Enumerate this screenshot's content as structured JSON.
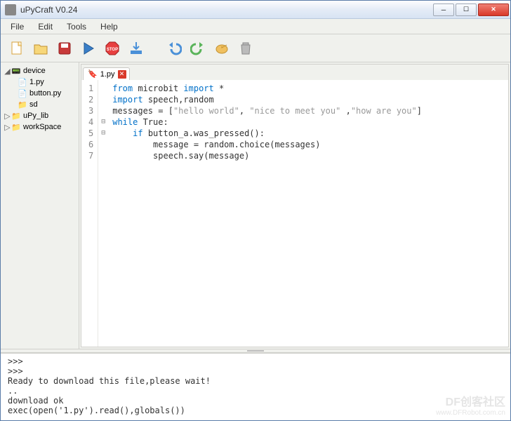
{
  "window": {
    "title": "uPyCraft V0.24"
  },
  "menu": {
    "file": "File",
    "edit": "Edit",
    "tools": "Tools",
    "help": "Help"
  },
  "toolbar": {
    "new": "new",
    "open": "open",
    "save": "save",
    "run": "run",
    "stop": "stop",
    "download": "download",
    "undo": "undo",
    "redo": "redo",
    "syntax": "syntax",
    "clear": "clear"
  },
  "tree": {
    "device": "device",
    "device_children": [
      "1.py",
      "button.py",
      "sd"
    ],
    "upy_lib": "uPy_lib",
    "workspace": "workSpace"
  },
  "tab": {
    "name": "1.py"
  },
  "code": {
    "lines": [
      [
        [
          "kw",
          "from"
        ],
        [
          "txt",
          " microbit "
        ],
        [
          "kw",
          "import"
        ],
        [
          "txt",
          " *"
        ]
      ],
      [
        [
          "kw",
          "import"
        ],
        [
          "txt",
          " speech,random"
        ]
      ],
      [
        [
          "txt",
          "messages = ["
        ],
        [
          "str",
          "\"hello world\""
        ],
        [
          "txt",
          ", "
        ],
        [
          "str",
          "\"nice to meet you\""
        ],
        [
          "txt",
          " ,"
        ],
        [
          "str",
          "\"how are you\""
        ],
        [
          "txt",
          "]"
        ]
      ],
      [
        [
          "kw",
          "while"
        ],
        [
          "txt",
          " True:"
        ]
      ],
      [
        [
          "txt",
          "    "
        ],
        [
          "kw",
          "if"
        ],
        [
          "txt",
          " button_a.was_pressed():"
        ]
      ],
      [
        [
          "txt",
          "        message = random.choice(messages)"
        ]
      ],
      [
        [
          "txt",
          "        speech.say(message)"
        ]
      ]
    ]
  },
  "console": ">>>\n>>>\nReady to download this file,please wait!\n..\ndownload ok\nexec(open('1.py').read(),globals())",
  "watermark": {
    "brand": "DF创客社区",
    "url": "www.DFRobot.com.cn"
  }
}
